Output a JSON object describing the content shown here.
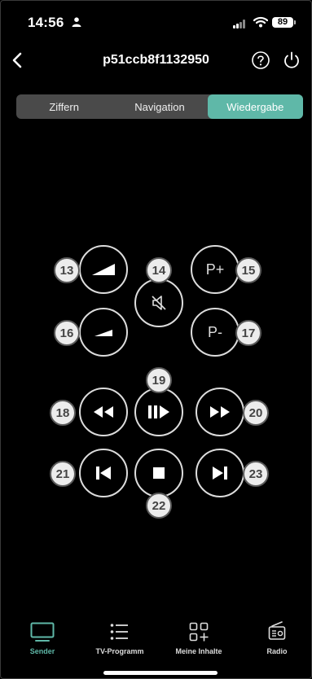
{
  "status": {
    "time": "14:56",
    "battery": "89"
  },
  "header": {
    "title": "p51ccb8f1132950"
  },
  "segments": [
    {
      "label": "Ziffern",
      "active": false
    },
    {
      "label": "Navigation",
      "active": false
    },
    {
      "label": "Wiedergabe",
      "active": true
    }
  ],
  "remote": {
    "prog_up_label": "P+",
    "prog_down_label": "P-",
    "badges": {
      "vol_up": "13",
      "mute": "14",
      "prog_up": "15",
      "vol_down": "16",
      "prog_down": "17",
      "rewind": "18",
      "play_pause": "19",
      "fast_forward": "20",
      "prev": "21",
      "stop": "22",
      "next": "23"
    }
  },
  "tabbar": [
    {
      "label": "Sender",
      "icon": "tv-icon",
      "active": true
    },
    {
      "label": "TV-Programm",
      "icon": "list-icon",
      "active": false
    },
    {
      "label": "Meine Inhalte",
      "icon": "grid-plus-icon",
      "active": false
    },
    {
      "label": "Radio",
      "icon": "radio-icon",
      "active": false
    }
  ],
  "colors": {
    "accent": "#5fb8a8",
    "background": "#000000",
    "segment_bg": "#4a4a4a"
  }
}
